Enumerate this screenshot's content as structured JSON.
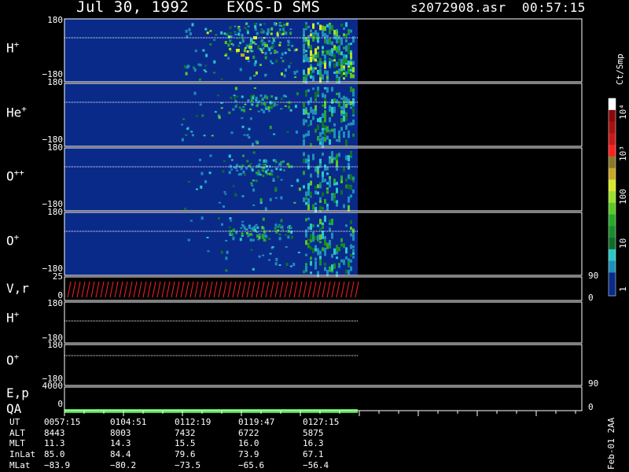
{
  "title": {
    "left": "Jul 30, 1992    EXOS-D SMS",
    "right": "s2072908.asr  00:57:15"
  },
  "colors": {
    "background": "#000000",
    "spectrogram_bg": "#0a2a8a",
    "vr_trace": "#ff2020",
    "qa_bar": "#44dd44",
    "colorbar": [
      "#0a2a8a",
      "#0a2a8a",
      "#1d8fb8",
      "#28c8c8",
      "#0e6e28",
      "#1a8c2a",
      "#28a828",
      "#5cc828",
      "#9ce028",
      "#d8e828",
      "#c8a828",
      "#8a7a28",
      "#ff2020",
      "#c81818",
      "#a81010",
      "#8a0808",
      "#ffffff"
    ]
  },
  "panels": [
    {
      "label": "H",
      "sup": "+",
      "y_top": "180",
      "y_bot": "−180"
    },
    {
      "label": "He",
      "sup": "+",
      "y_top": "180",
      "y_bot": "−180"
    },
    {
      "label": "O",
      "sup": "++",
      "y_top": "180",
      "y_bot": "−180"
    },
    {
      "label": "O",
      "sup": "+",
      "y_top": "180",
      "y_bot": "−180"
    }
  ],
  "vr": {
    "label": "V,r",
    "y_top": "25",
    "y_bot": "0",
    "r_top": "90",
    "r_bot": "0"
  },
  "h_line": {
    "label": "H",
    "sup": "+",
    "y_top": "180",
    "y_bot": "−180"
  },
  "o_line": {
    "label": "O",
    "sup": "+",
    "y_top": "180",
    "y_bot": "−180"
  },
  "ep": {
    "label": "E,p",
    "y_top": "4000",
    "y_bot": "0",
    "r_top": "90",
    "r_bot": "0"
  },
  "qa": {
    "label": "QA"
  },
  "colorbar": {
    "label": "Ct/Smp",
    "ticks": [
      "1",
      "10",
      "100",
      "10³",
      "10⁴"
    ]
  },
  "footer": "Feb-01 2AA",
  "axis_table": {
    "names": [
      "UT",
      "ALT",
      "MLT",
      "InLat",
      "MLat"
    ],
    "columns": [
      [
        "0057:15",
        "8443",
        "11.3",
        "85.0",
        "−83.9"
      ],
      [
        "0104:51",
        "8003",
        "14.3",
        "84.4",
        "−80.2"
      ],
      [
        "0112:19",
        "7432",
        "15.5",
        "79.6",
        "−73.5"
      ],
      [
        "0119:47",
        "6722",
        "16.0",
        "73.9",
        "−65.6"
      ],
      [
        "0127:15",
        "5875",
        "16.3",
        "67.1",
        "−56.4"
      ]
    ]
  },
  "chart_data": {
    "type": "heatmap",
    "title": "Jul 30, 1992    EXOS-D SMS",
    "x_ticks": [
      "0057:15",
      "0104:51",
      "0112:19",
      "0119:47",
      "0127:15"
    ],
    "colorbar_ticks": [
      "1",
      "10",
      "100",
      "10³",
      "10⁴"
    ],
    "colorbar_label": "Ct/Smp",
    "series": [
      {
        "name": "H+",
        "ylim": [
          -180,
          180
        ]
      },
      {
        "name": "He+",
        "ylim": [
          -180,
          180
        ]
      },
      {
        "name": "O++",
        "ylim": [
          -180,
          180
        ]
      },
      {
        "name": "O+",
        "ylim": [
          -180,
          180
        ]
      }
    ]
  }
}
